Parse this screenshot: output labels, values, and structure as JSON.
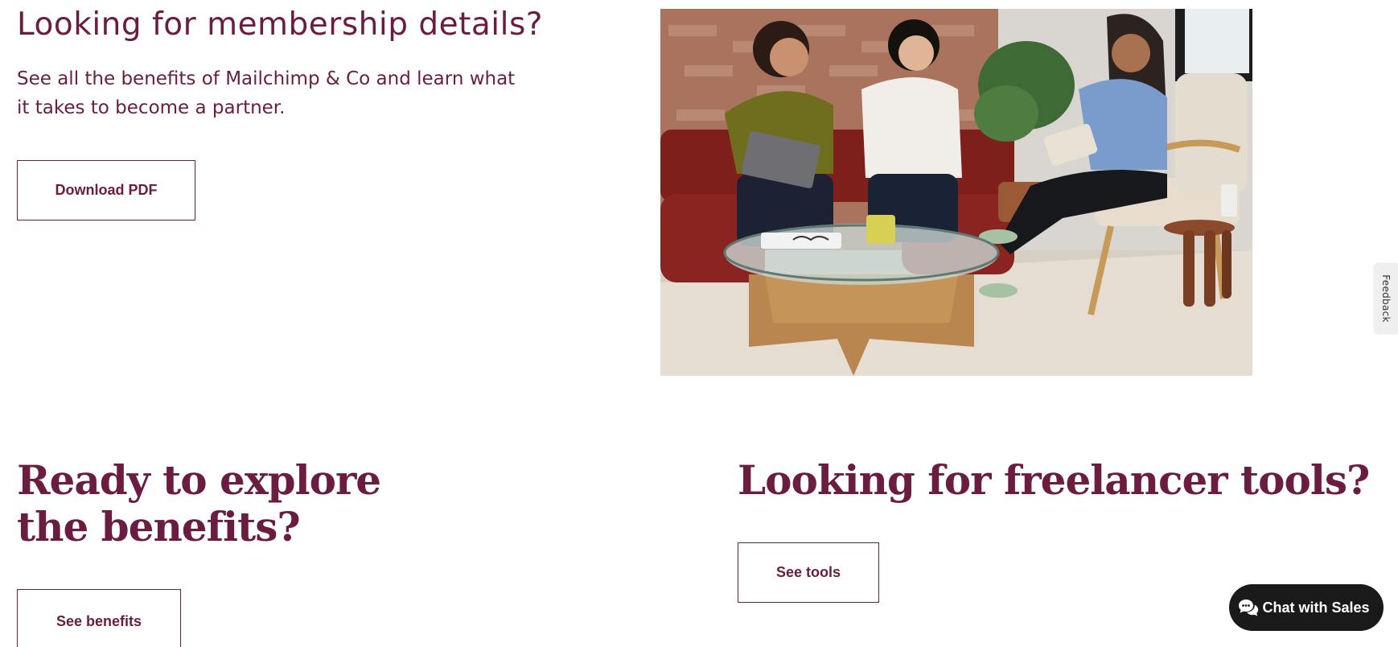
{
  "membership": {
    "heading": "Looking for membership details?",
    "description": "See all the benefits of Mailchimp & Co and learn what it takes to become a partner.",
    "download_label": "Download PDF"
  },
  "explore": {
    "heading": "Ready to explore the benefits?",
    "button_label": "See benefits"
  },
  "freelancer": {
    "heading": "Looking for freelancer tools?",
    "button_label": "See tools"
  },
  "feedback": {
    "label": "Feedback"
  },
  "chat": {
    "label": "Chat with Sales",
    "icon": "chat-bubbles-icon"
  },
  "colors": {
    "brand": "#6a1d41",
    "chat_background": "#1a1a1a",
    "page_background": "#ffffff"
  }
}
